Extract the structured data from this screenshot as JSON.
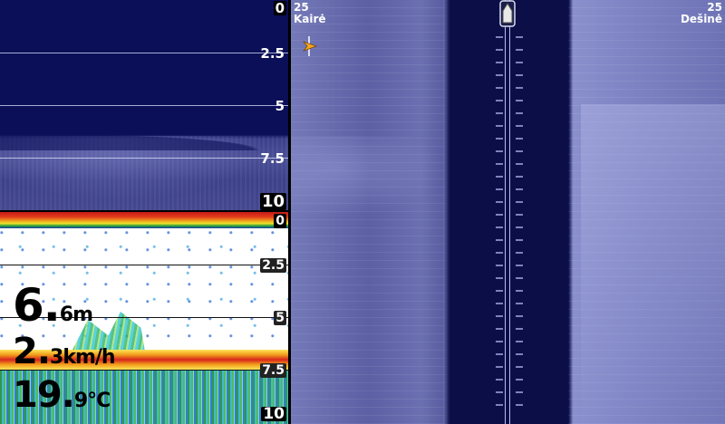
{
  "down_imaging": {
    "scale": [
      "0",
      "2.5",
      "5",
      "7.5",
      "10"
    ]
  },
  "sonar_2d": {
    "scale": [
      "0",
      "2.5",
      "5",
      "7.5",
      "10"
    ],
    "depth": {
      "value": "6.",
      "decimal": "6",
      "unit": "m"
    },
    "speed": {
      "value": "2.",
      "decimal": "3",
      "unit": "km/h"
    },
    "temperature": {
      "value": "19.",
      "decimal": "9",
      "unit": "°C"
    }
  },
  "side_imaging": {
    "left_range": "25",
    "left_label": "Kairė",
    "right_range": "25",
    "right_label": "Dešinė"
  },
  "icons": {
    "boat": "boat-icon",
    "cursor": "cursor-arrow-icon"
  },
  "colors": {
    "water": "#0a0f57",
    "side_imaging_bottom": "#6b70b1",
    "sonar_bottom": "#d8261d"
  }
}
